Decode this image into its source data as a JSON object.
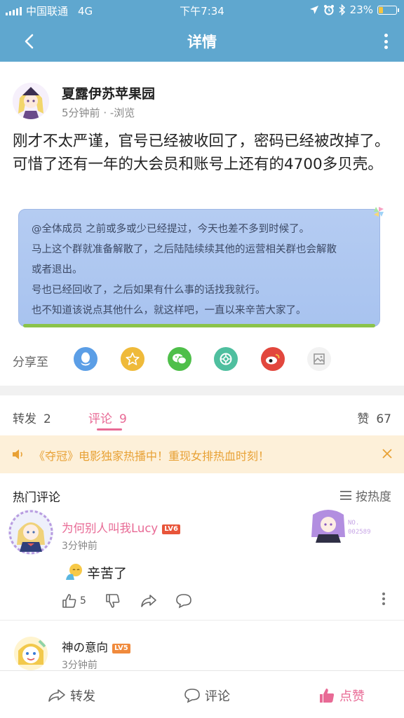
{
  "status_bar": {
    "carrier": "中国联通",
    "network": "4G",
    "time": "下午7:34",
    "battery_percent": "23%",
    "battery_level": 0.23
  },
  "header": {
    "title": "详情"
  },
  "post": {
    "author": "夏露伊苏苹果园",
    "time": "5分钟前",
    "views": "-浏览",
    "content": "刚才不太严谨，官号已经被收回了，密码已经被改掉了。可惜了还有一年的大会员和账号上还有的4700多贝壳。",
    "image_lines": [
      "@全体成员 之前或多或少已经提过，今天也差不多到时候了。",
      "马上这个群就准备解散了，之后陆陆续续其他的运营相关群也会解散",
      "或者退出。",
      "号也已经回收了，之后如果有什么事的话找我就行。",
      "也不知道该说点其他什么，就这样吧，一直以来辛苦大家了。"
    ]
  },
  "share": {
    "label": "分享至",
    "icons": [
      "qq-icon",
      "qzone-icon",
      "wechat-icon",
      "moments-icon",
      "weibo-icon",
      "image-icon"
    ]
  },
  "tabs": [
    {
      "label": "转发",
      "count": "2"
    },
    {
      "label": "评论",
      "count": "9"
    },
    {
      "label": "赞",
      "count": "67"
    }
  ],
  "notice": {
    "text": "《夺冠》电影独家热播中！重现女排热血时刻！"
  },
  "comments_section": {
    "title": "热门评论",
    "sort_label": "按热度"
  },
  "comments": [
    {
      "name": "为何别人叫我Lucy",
      "level": "LV6",
      "time": "3分钟前",
      "text": "辛苦了",
      "likes": "5",
      "badge_label": "NO.",
      "badge_number": "002589"
    },
    {
      "name": "神の意向",
      "level": "LV5",
      "time": "3分钟前"
    }
  ],
  "bottom_bar": {
    "repost": "转发",
    "comment": "评论",
    "like": "点赞"
  },
  "colors": {
    "header_bg": "#5fa7cf",
    "accent_pink": "#e86a95",
    "notice_bg": "#fdf0d9",
    "notice_text": "#e8a135",
    "level_badge": "#e8553a"
  }
}
